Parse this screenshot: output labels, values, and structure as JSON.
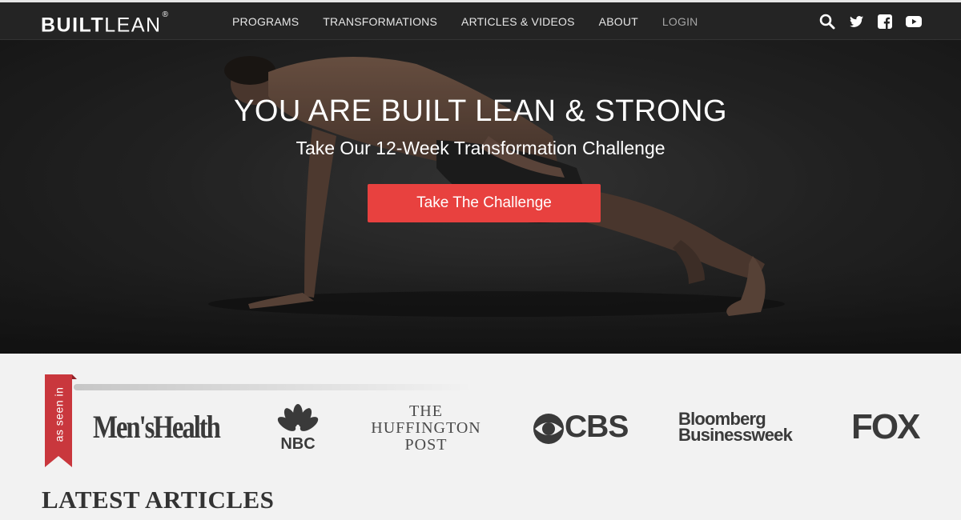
{
  "nav": {
    "logo_bold": "BUILT",
    "logo_light": "LEAN",
    "logo_mark": "®",
    "items": [
      {
        "label": "PROGRAMS"
      },
      {
        "label": "TRANSFORMATIONS"
      },
      {
        "label": "ARTICLES & VIDEOS"
      },
      {
        "label": "ABOUT"
      },
      {
        "label": "LOGIN"
      }
    ],
    "social_icons": [
      "search-icon",
      "twitter-icon",
      "facebook-icon",
      "youtube-icon"
    ]
  },
  "hero": {
    "title": "YOU ARE BUILT LEAN & STRONG",
    "subtitle": "Take Our 12-Week Transformation Challenge",
    "cta_label": "Take The Challenge",
    "cta_color": "#e8413f"
  },
  "press": {
    "ribbon_label": "as seen in",
    "ribbon_color": "#c9373d",
    "logos": {
      "mens_health": "Men'sHealth",
      "nbc": "NBC",
      "huffington_lines": [
        "THE",
        "HUFFINGTON",
        "POST"
      ],
      "cbs": "CBS",
      "bloomberg_lines": [
        "Bloomberg",
        "Businessweek"
      ],
      "fox": "FOX"
    }
  },
  "latest": {
    "heading": "LATEST ARTICLES"
  }
}
